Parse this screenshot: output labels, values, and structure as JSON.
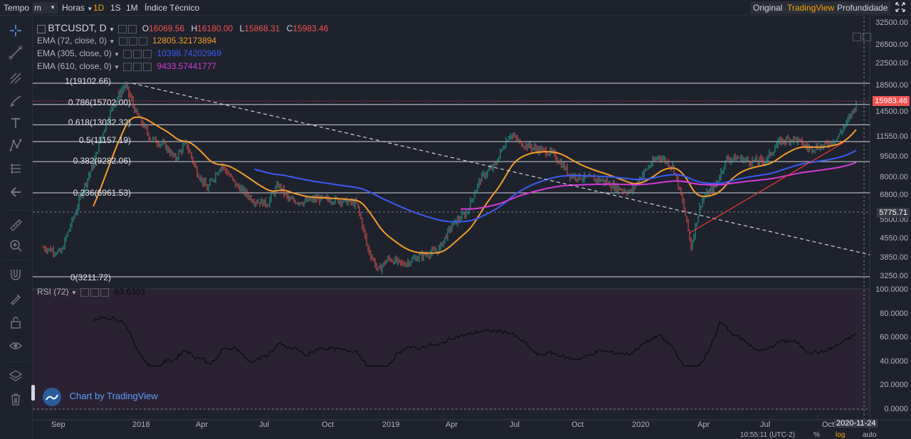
{
  "toolbar": {
    "tempo": "Tempo",
    "interval_select": "m",
    "horas": "Horas",
    "intervals": [
      "1D",
      "1S",
      "1M"
    ],
    "active_interval": "1D",
    "indicators": "Índice Técnico",
    "views": [
      "Original",
      "TradingView",
      "Profundidade"
    ],
    "active_view": "TradingView"
  },
  "chart": {
    "symbol": "BTCUSDT, D",
    "ohlc": {
      "o_label": "O",
      "o": "16069.56",
      "h_label": "H",
      "h": "16180.00",
      "l_label": "L",
      "l": "15868.31",
      "c_label": "C",
      "c": "15983.46"
    },
    "ema": [
      {
        "label": "EMA (72, close, 0)",
        "value": "12805.32173894",
        "color": "#f59c2b"
      },
      {
        "label": "EMA (305, close, 0)",
        "value": "10398.74202969",
        "color": "#3a5cf0"
      },
      {
        "label": "EMA (610, close, 0)",
        "value": "9433.57441777",
        "color": "#d63ad6"
      }
    ],
    "fib_levels": [
      {
        "label": "1(19102.66)",
        "price": 19102.66
      },
      {
        "label": "0.786(15702.00)",
        "price": 15702.0
      },
      {
        "label": "0.618(13032.32)",
        "price": 13032.32
      },
      {
        "label": "0.5(11157.19)",
        "price": 11157.19
      },
      {
        "label": "0.382(9282.06)",
        "price": 9282.06
      },
      {
        "label": "0.236(6961.53)",
        "price": 6961.53
      },
      {
        "label": "0(3211.72)",
        "price": 3211.72
      }
    ],
    "price_axis": [
      "32500.00",
      "26500.00",
      "22500.00",
      "18500.00",
      "14500.00",
      "11550.00",
      "9500.00",
      "8000.00",
      "6800.00",
      "5500.00",
      "4550.00",
      "3850.00",
      "3250.00"
    ],
    "last_price": "15983.46",
    "crosshair_price": "5775.71",
    "time_axis": [
      "Sep",
      "2018",
      "Apr",
      "Jul",
      "Oct",
      "2019",
      "Apr",
      "Jul",
      "Oct",
      "2020",
      "Apr",
      "Jul",
      "Oct"
    ],
    "crosshair_date": "2020-11-24",
    "rsi": {
      "label": "RSI (72)",
      "value": "63.6303",
      "axis": [
        "100.0000",
        "80.0000",
        "60.0000",
        "40.0000",
        "20.0000",
        "0.0000"
      ]
    },
    "watermark": "Chart by TradingView",
    "status": {
      "time": "10:55:11 (UTC-2)",
      "percent": "%",
      "log": "log",
      "auto": "auto"
    }
  },
  "colors": {
    "background": "#1e222d",
    "accent": "#f7a600",
    "up": "#26a69a",
    "down": "#ef5350",
    "fib_line": "#d1d4dc"
  }
}
